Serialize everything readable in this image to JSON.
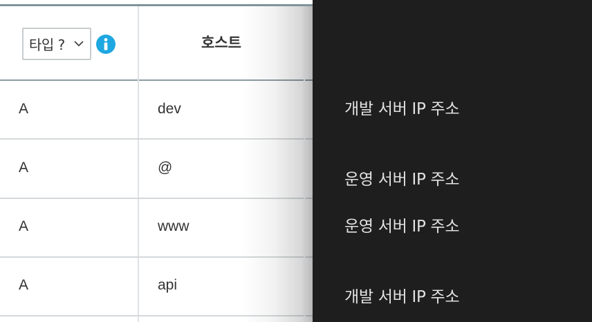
{
  "table": {
    "type_select_value": "타입 ?",
    "host_header": "호스트",
    "rows": [
      {
        "type": "A",
        "host": "dev"
      },
      {
        "type": "A",
        "host": "@"
      },
      {
        "type": "A",
        "host": "www"
      },
      {
        "type": "A",
        "host": "api"
      }
    ]
  },
  "descriptions": [
    "개발 서버 IP 주소",
    "운영 서버 IP 주소",
    "운영 서버 IP 주소",
    "개발 서버 IP 주소"
  ],
  "colors": {
    "info_icon": "#1ea7e0",
    "dark_panel": "#1e1e1e",
    "description_text": "#e2e2e2"
  },
  "icons": {
    "dropdown": "chevron-down-icon",
    "info": "info-icon"
  }
}
